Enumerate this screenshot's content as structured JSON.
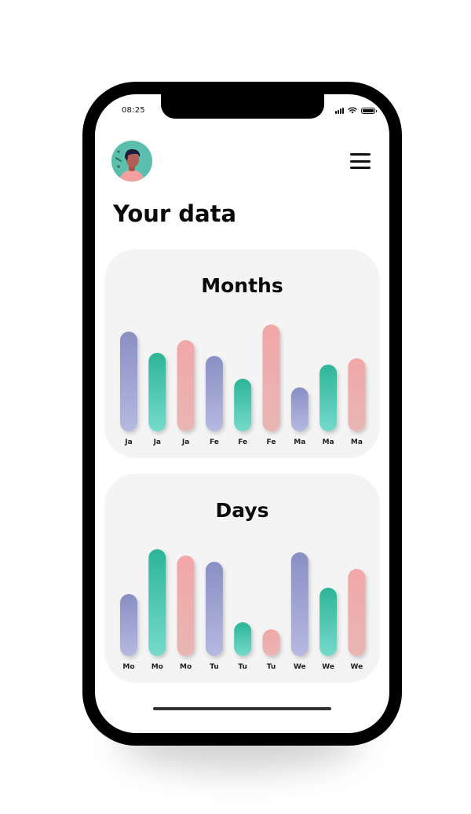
{
  "status": {
    "time": "08:25"
  },
  "header": {
    "title": "Your data"
  },
  "icons": {
    "avatar": "user-avatar",
    "menu": "hamburger-menu-icon"
  },
  "colors": {
    "purple": [
      "#8a8fc4",
      "#b6b9e0"
    ],
    "green": [
      "#2db597",
      "#76dacb"
    ],
    "pink": [
      "#f2a7a8",
      "#e8b6b3"
    ],
    "card_bg": "#f4f4f4"
  },
  "chart_data": [
    {
      "type": "bar",
      "title": "Months",
      "categories": [
        "Ja",
        "Ja",
        "Ja",
        "Fe",
        "Fe",
        "Fe",
        "Ma",
        "Ma",
        "Ma"
      ],
      "values": [
        127,
        100,
        116,
        96,
        67,
        136,
        56,
        85,
        93
      ],
      "colors": [
        "purple",
        "green",
        "pink",
        "purple",
        "green",
        "pink",
        "purple",
        "green",
        "pink"
      ]
    },
    {
      "type": "bar",
      "title": "Days",
      "categories": [
        "Mo",
        "Mo",
        "Mo",
        "Tu",
        "Tu",
        "Tu",
        "We",
        "We",
        "We"
      ],
      "values": [
        79,
        136,
        128,
        120,
        43,
        34,
        132,
        87,
        111
      ],
      "colors": [
        "purple",
        "green",
        "pink",
        "purple",
        "green",
        "pink",
        "purple",
        "green",
        "pink"
      ]
    }
  ]
}
